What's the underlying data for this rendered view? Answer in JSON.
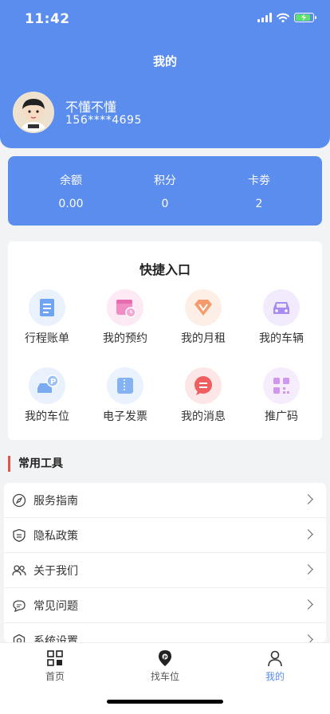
{
  "status_bar": {
    "time": "11:42"
  },
  "header": {
    "title": "我的"
  },
  "user": {
    "name": "不懂不懂",
    "phone": "156****4695"
  },
  "stats": [
    {
      "label": "余额",
      "value": "0.00"
    },
    {
      "label": "积分",
      "value": "0"
    },
    {
      "label": "卡劵",
      "value": "2"
    }
  ],
  "quick": {
    "title": "快捷入口",
    "items": [
      {
        "label": "行程账单",
        "icon": "bill-icon"
      },
      {
        "label": "我的预约",
        "icon": "calendar-clock-icon"
      },
      {
        "label": "我的月租",
        "icon": "diamond-icon"
      },
      {
        "label": "我的车辆",
        "icon": "car-icon"
      },
      {
        "label": "我的车位",
        "icon": "parking-car-icon"
      },
      {
        "label": "电子发票",
        "icon": "ticket-icon"
      },
      {
        "label": "我的消息",
        "icon": "message-icon"
      },
      {
        "label": "推广码",
        "icon": "qrcode-icon"
      }
    ]
  },
  "tools": {
    "title": "常用工具",
    "items": [
      {
        "label": "服务指南",
        "icon": "compass-icon"
      },
      {
        "label": "隐私政策",
        "icon": "shield-icon"
      },
      {
        "label": "关于我们",
        "icon": "users-icon"
      },
      {
        "label": "常见问题",
        "icon": "chat-icon"
      },
      {
        "label": "系统设置",
        "icon": "settings-icon"
      }
    ]
  },
  "tabbar": {
    "items": [
      {
        "label": "首页",
        "icon": "grid-icon"
      },
      {
        "label": "找车位",
        "icon": "location-pin-icon"
      },
      {
        "label": "我的",
        "icon": "user-icon"
      }
    ],
    "active": "我的"
  },
  "colors": {
    "primary": "#5b8def",
    "accent": "#e0544a",
    "battery": "#5fe36b"
  }
}
